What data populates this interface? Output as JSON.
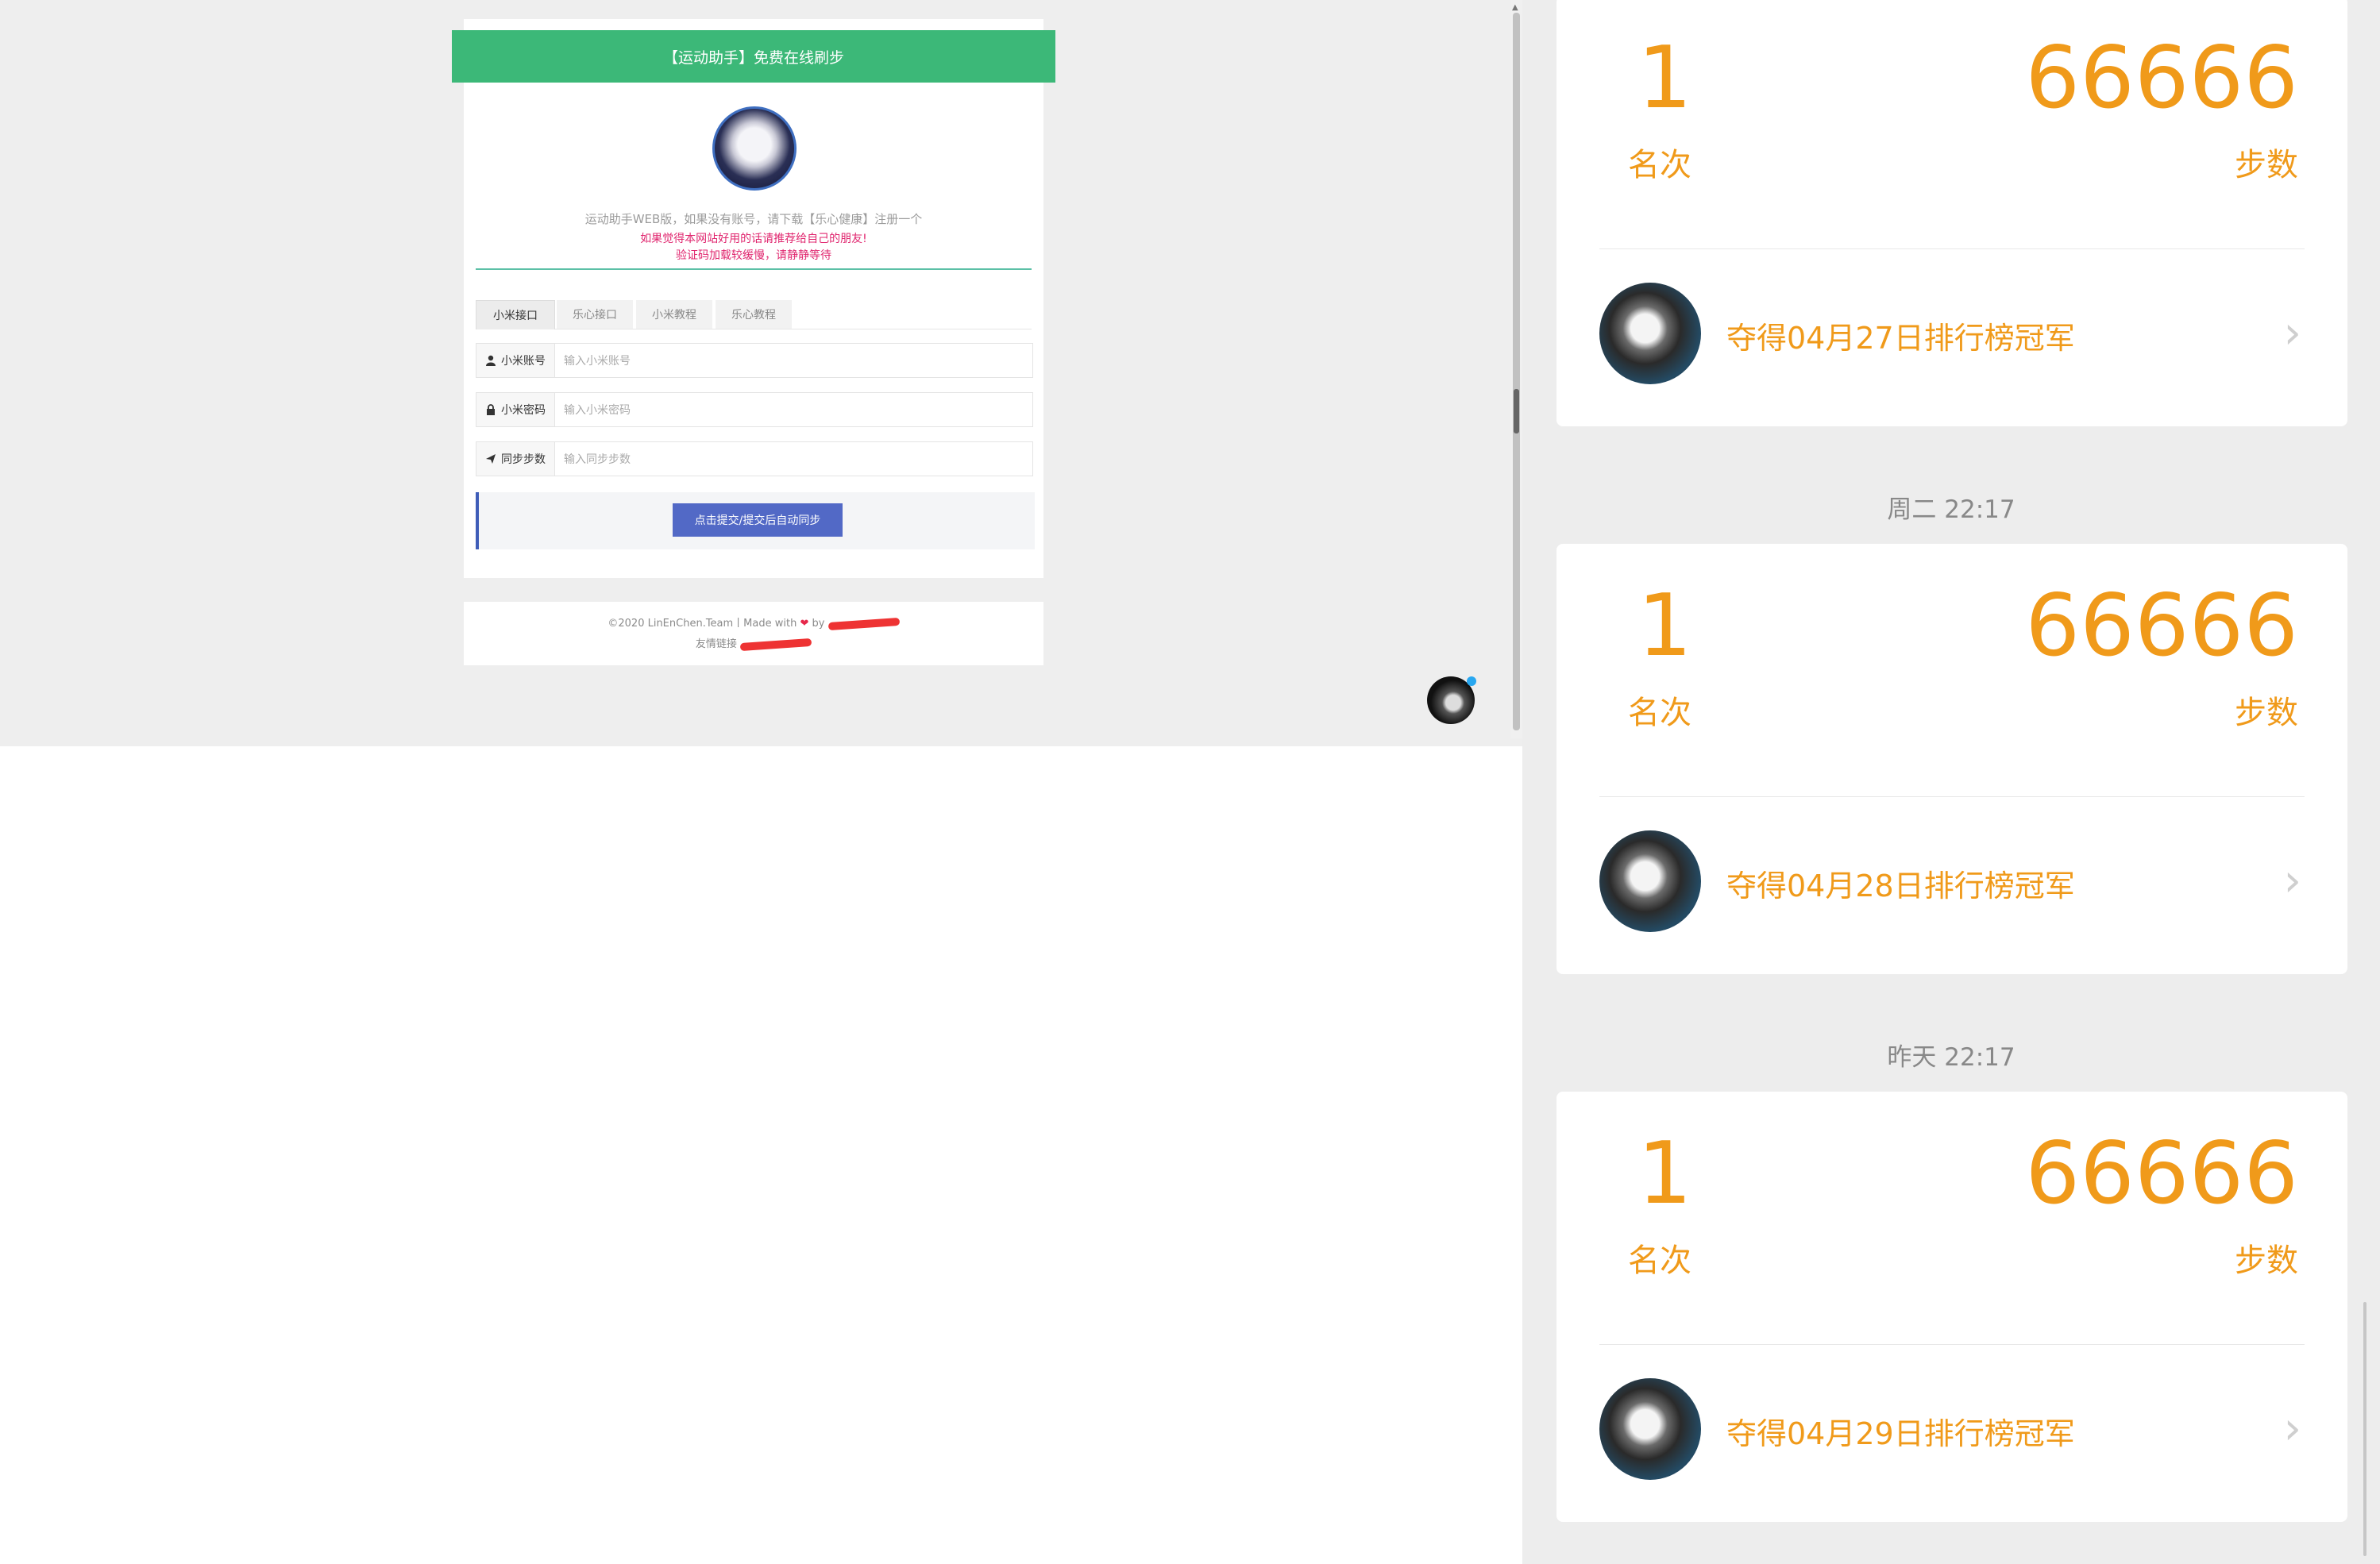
{
  "left": {
    "header_title": "【运动助手】免费在线刷步",
    "intro_line1": "运动助手WEB版，如果没有账号，请下载【乐心健康】注册一个",
    "intro_line2": "如果觉得本网站好用的话请推荐给自己的朋友!",
    "intro_line3": "验证码加载较缓慢，请静静等待",
    "tabs": [
      {
        "label": "小米接口"
      },
      {
        "label": "乐心接口"
      },
      {
        "label": "小米教程"
      },
      {
        "label": "乐心教程"
      }
    ],
    "fields": {
      "account": {
        "label": "小米账号",
        "placeholder": "输入小米账号",
        "icon": "user-icon"
      },
      "password": {
        "label": "小米密码",
        "placeholder": "输入小米密码",
        "icon": "lock-icon"
      },
      "steps": {
        "label": "同步步数",
        "placeholder": "输入同步步数",
        "icon": "send-icon"
      }
    },
    "submit_label": "点击提交/提交后自动同步",
    "footer_line1_prefix": "©2020 LinEnChen.Team丨Made with",
    "footer_line1_suffix": "by",
    "footer_line2_prefix": "友情链接",
    "colors": {
      "header": "#3cb878",
      "submit": "#5269c6",
      "highlight": "#e0256e"
    }
  },
  "right": {
    "cards": [
      {
        "rank": "1",
        "rank_label": "名次",
        "steps": "66666",
        "steps_label": "步数",
        "champion": "夺得04月27日排行榜冠军"
      },
      {
        "rank": "1",
        "rank_label": "名次",
        "steps": "66666",
        "steps_label": "步数",
        "champion": "夺得04月28日排行榜冠军"
      },
      {
        "rank": "1",
        "rank_label": "名次",
        "steps": "66666",
        "steps_label": "步数",
        "champion": "夺得04月29日排行榜冠军"
      }
    ],
    "time_labels": [
      "周二 22:17",
      "昨天 22:17"
    ],
    "accent": "#f09a1a"
  }
}
